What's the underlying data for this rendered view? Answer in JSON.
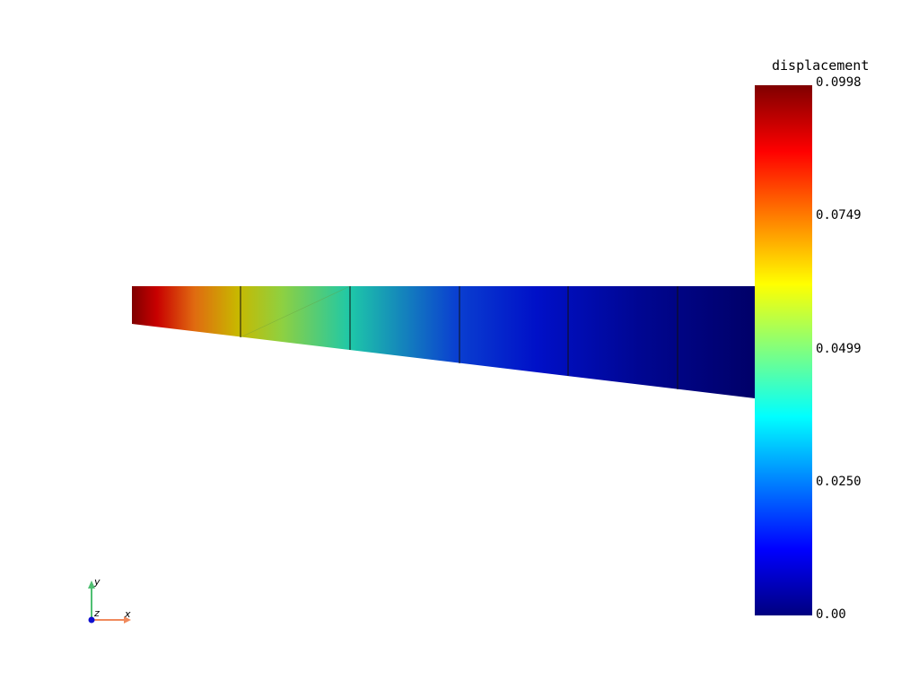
{
  "colorbar": {
    "title": "displacement",
    "ticks": [
      "0.0998",
      "0.0749",
      "0.0499",
      "0.0250",
      "0.00"
    ],
    "colormap": "jet"
  },
  "orientation_axes": {
    "x_label": "x",
    "y_label": "y",
    "z_label": "z",
    "x_color": "#f08a5d",
    "y_color": "#4fbf72",
    "z_color": "#1010d0"
  },
  "mesh": {
    "element_displacement_range": [
      [
        0.0998,
        0.065
      ],
      [
        0.065,
        0.045
      ],
      [
        0.045,
        0.025
      ],
      [
        0.025,
        0.012
      ],
      [
        0.012,
        0.004
      ],
      [
        0.004,
        0.0
      ]
    ]
  }
}
